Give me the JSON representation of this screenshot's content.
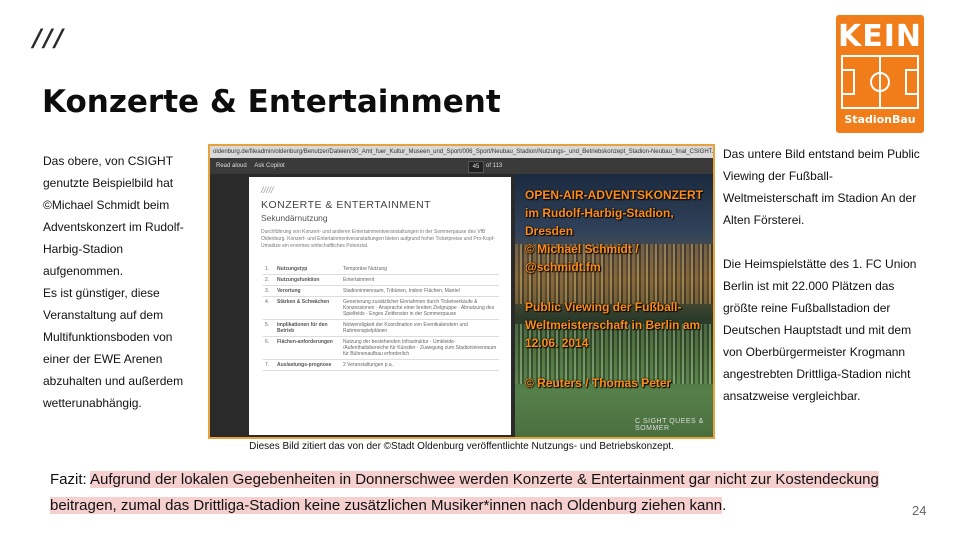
{
  "slide": {
    "slashes": "///",
    "title": "Konzerte & Entertainment",
    "logo": {
      "line1": "KEIN",
      "line2": "StadionBau",
      "color": "#f07d1a"
    },
    "left_text": {
      "para1": "Das obere, von CSIGHT genutzte Beispielbild hat ©Michael Schmidt beim Adventskonzert  im Rudolf-Harbig-Stadion aufgenommen.",
      "para2": "Es ist günstiger, diese Veranstaltung auf dem Multifunktionsboden von einer der EWE Arenen abzuhalten und außerdem wetterunabhängig."
    },
    "right_text": {
      "para1": "Das untere Bild entstand beim Public Viewing der Fußball-Weltmeisterschaft im Stadion An der Alten Försterei.",
      "para2": "Die Heimspielstätte des 1. FC Union Berlin ist mit 22.000 Plätzen das größte reine Fußballstadion der Deutschen Hauptstadt und mit dem von Oberbürgermeister Krogmann angestrebten Drittliga-Stadion nicht ansatzweise vergleichbar."
    },
    "screenshot": {
      "url": "oldenburg.de/fileadmin/oldenburg/Benutzer/Dateien/30_Amt_fuer_Kultur_Museen_und_Sport/006_Sport/Neubau_Stadion/Nutzungs-_und_Betriebskonzept_Stadion-Neubau_final_CSIGHT.pdf",
      "toolbar": {
        "read_aloud": "Read aloud",
        "ask_copilot": "Ask Copilot",
        "page_no": "45",
        "page_count": "of 113"
      },
      "doc": {
        "marks": "/////",
        "heading": "KONZERTE & ENTERTAINMENT",
        "subheading": "Sekundärnutzung",
        "intro": "Durchführung von Konzert- und anderen Entertainmentveranstaltungen in der Sommerpause des VfB Oldenburg. Konzert- und Entertainmentveranstaltungen bieten aufgrund hoher Ticketpreise und Pro-Kopf-Umsätze ein enormes wirtschaftliches Potenzial.",
        "rows": [
          {
            "num": "1.",
            "key": "Nutzungstyp",
            "value": "Temporäre Nutzung"
          },
          {
            "num": "2.",
            "key": "Nutzungsfunktion",
            "value": "Entertainment"
          },
          {
            "num": "3.",
            "key": "Verortung",
            "value": "Stadioninnenraum, Tribünen, Indoor Flächen, Mantel"
          },
          {
            "num": "4.",
            "key": "Stärken & Schwächen",
            "value": "Generierung zusätzlicher Einnahmen durch Ticketverkäufe & Konzessionen · Ansprache einer breiten Zielgruppe · Abnutzung des Spielfelds · Enges Zeitfenster in der Sommerpause"
          },
          {
            "num": "5.",
            "key": "Implikationen für den Betrieb",
            "value": "Notwendigkeit der Koordination von Eventkalendern und Rahmenspielplänen"
          },
          {
            "num": "6.",
            "key": "Flächen-anforderungen",
            "value": "Nutzung der bestehenden Infrastruktur · Umkleide- /Aufenthaltsbereiche für Künstler · Zuwegung zum Stadioninnenraum für Bühnenaufbau erforderlich"
          },
          {
            "num": "7.",
            "key": "Auslastungs-prognose",
            "value": "2 Veranstaltungen p.a."
          }
        ]
      },
      "photo": {
        "caption1": "OPEN-AIR-ADVENTSKONZERT im Rudolf-Harbig-Stadion, Dresden",
        "caption2": "© Michael Schmidt / @schmidt.fm",
        "caption3": "Public Viewing der Fußball-Weltmeisterschaft in Berlin am 12.06. 2014",
        "caption4": "© Reuters / Thomas Peter",
        "watermark": "C SIGHT  QUEES & SOMMER"
      }
    },
    "screenshot_caption": "Dieses Bild zitiert das von der ©Stadt Oldenburg veröffentlichte Nutzungs- und Betriebskonzept.",
    "fazit": {
      "label": "Fazit: ",
      "text": "Aufgrund der lokalen Gegebenheiten in Donnerschwee werden Konzerte & Entertainment gar nicht zur Kostendeckung beitragen, zumal das Drittliga-Stadion keine zusätzlichen Musiker*innen nach Oldenburg ziehen kann",
      "end": "."
    },
    "page_number": "24"
  }
}
